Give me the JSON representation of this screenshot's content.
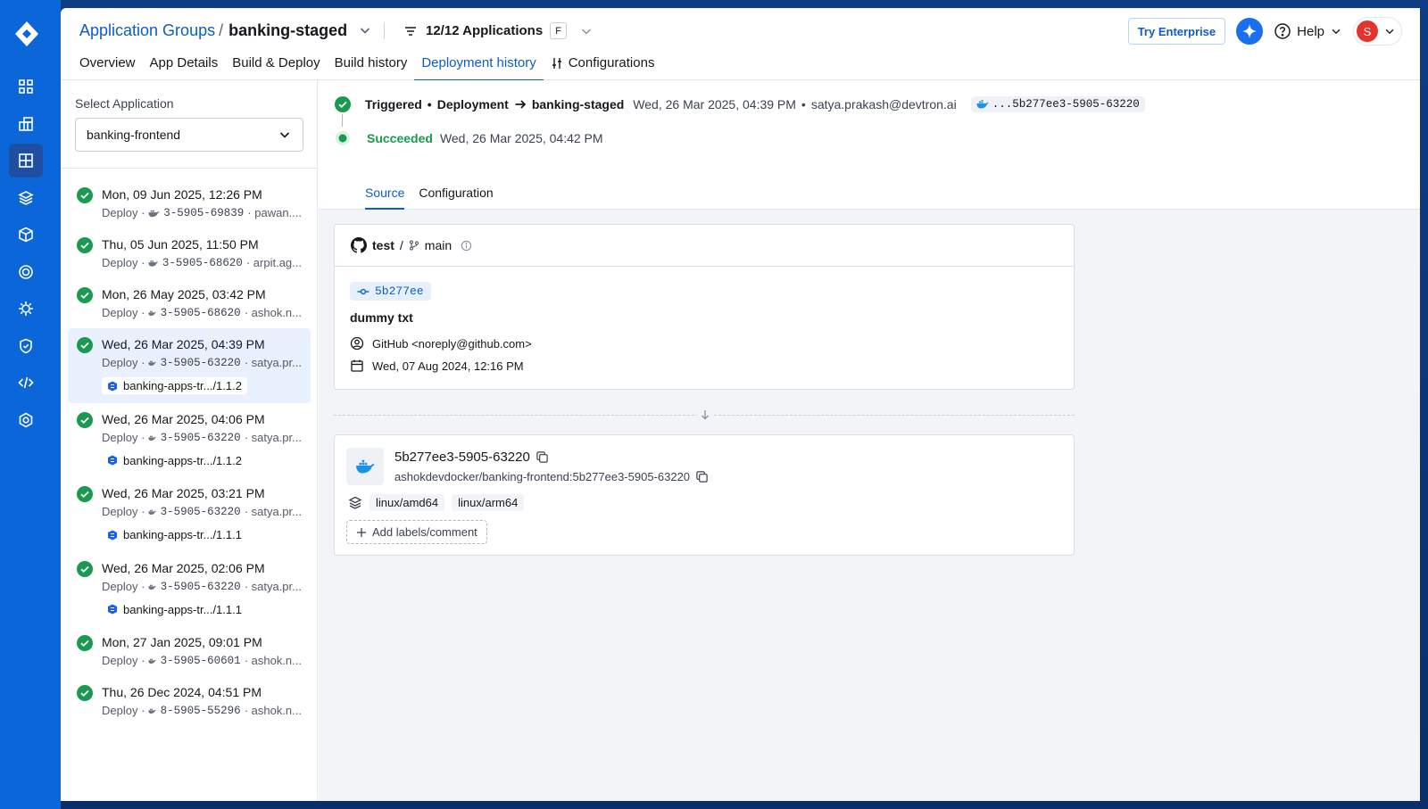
{
  "header": {
    "breadcrumb_link": "Application Groups",
    "breadcrumb_sep": "/",
    "current_group": "banking-staged",
    "apps_count": "12/12 Applications",
    "filter_badge": "F",
    "try_enterprise": "Try Enterprise",
    "help": "Help",
    "avatar_initial": "S"
  },
  "tabs": [
    "Overview",
    "App Details",
    "Build & Deploy",
    "Build history",
    "Deployment history",
    "Configurations"
  ],
  "sidebar": {
    "select_label": "Select Application",
    "selected_app": "banking-frontend",
    "deployments": [
      {
        "date": "Mon, 09 Jun 2025, 12:26 PM",
        "type": "Deploy ·",
        "image": "3-5905-69839",
        "user": "· pawan...."
      },
      {
        "date": "Thu, 05 Jun 2025, 11:50 PM",
        "type": "Deploy ·",
        "image": "3-5905-68620",
        "user": "· arpit.ag..."
      },
      {
        "date": "Mon, 26 May 2025, 03:42 PM",
        "type": "Deploy ·",
        "image": "3-5905-68620",
        "user": "· ashok.n..."
      },
      {
        "date": "Wed, 26 Mar 2025, 04:39 PM",
        "type": "Deploy ·",
        "image": "3-5905-63220",
        "user": "· satya.pr...",
        "chart": "banking-apps-tr.../1.1.2"
      },
      {
        "date": "Wed, 26 Mar 2025, 04:06 PM",
        "type": "Deploy ·",
        "image": "3-5905-63220",
        "user": "· satya.pr...",
        "chart": "banking-apps-tr.../1.1.2"
      },
      {
        "date": "Wed, 26 Mar 2025, 03:21 PM",
        "type": "Deploy ·",
        "image": "3-5905-63220",
        "user": "· satya.pr...",
        "chart": "banking-apps-tr.../1.1.1"
      },
      {
        "date": "Wed, 26 Mar 2025, 02:06 PM",
        "type": "Deploy ·",
        "image": "3-5905-63220",
        "user": "· satya.pr...",
        "chart": "banking-apps-tr.../1.1.1"
      },
      {
        "date": "Mon, 27 Jan 2025, 09:01 PM",
        "type": "Deploy ·",
        "image": "3-5905-60601",
        "user": "· ashok.n..."
      },
      {
        "date": "Thu, 26 Dec 2024, 04:51 PM",
        "type": "Deploy ·",
        "image": "8-5905-55296",
        "user": "· ashok.n..."
      }
    ]
  },
  "detail": {
    "triggered": "Triggered",
    "bullet": "•",
    "deployment": "Deployment",
    "target": "banking-staged",
    "trigger_time": "Wed, 26 Mar 2025, 04:39 PM",
    "user": "satya.prakash@devtron.ai",
    "image_tag": "...5b277ee3-5905-63220",
    "status": "Succeeded",
    "status_time": "Wed, 26 Mar 2025, 04:42 PM",
    "subtabs": [
      "Source",
      "Configuration"
    ]
  },
  "source": {
    "repo": "test",
    "branch_sep": "/",
    "branch": "main",
    "commit": "5b277ee",
    "message": "dummy txt",
    "author": "GitHub <noreply@github.com>",
    "date": "Wed, 07 Aug 2024, 12:16 PM"
  },
  "artifact": {
    "tag": "5b277ee3-5905-63220",
    "image": "ashokdevdocker/banking-frontend:5b277ee3-5905-63220",
    "platforms": [
      "linux/amd64",
      "linux/arm64"
    ],
    "add_labels": "Add labels/comment"
  },
  "colors": {
    "accent": "#0b5cc9",
    "success": "#1a9a50",
    "rail": "#0a66d9"
  }
}
